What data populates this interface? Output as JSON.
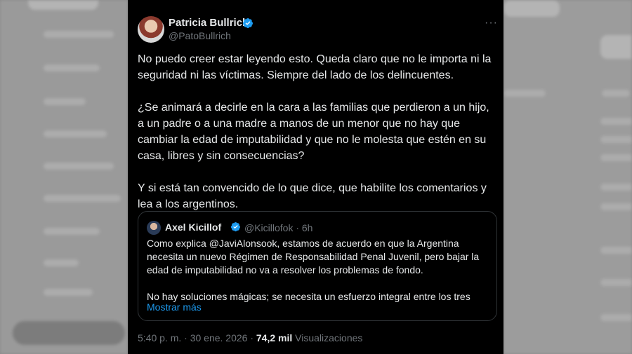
{
  "author": {
    "name": "Patricia Bullrich",
    "handle": "@PatoBullrich"
  },
  "tweet": {
    "paragraphs": [
      "No puedo creer estar leyendo esto. Queda claro que no le importa ni la seguridad ni las víctimas. Siempre del lado de los delincuentes.",
      "¿Se animará a decirle en la cara a las familias que perdieron a un hijo, a un padre o a una madre a manos de un menor que no hay que cambiar la edad de imputabilidad y que no le molesta que estén en su casa, libres y sin consecuencias?",
      "Y si está tan convencido de lo que dice, que habilite los comentarios y lea a los argentinos."
    ]
  },
  "quote": {
    "name": "Axel Kicillof",
    "handle_time": "@Kicillofok · 6h",
    "paragraphs": [
      "Como explica @JaviAlonsook, estamos de acuerdo en que la Argentina necesita un nuevo Régimen de Responsabilidad Penal Juvenil, pero bajar la edad de imputabilidad no va a resolver los problemas de fondo.",
      "No hay soluciones mágicas; se necesita un esfuerzo integral entre los tres"
    ],
    "show_more": "Mostrar más"
  },
  "meta": {
    "time_date": "5:40 p. m. · 30 ene. 2026 · ",
    "views_count": "74,2 mil",
    "views_label": " Visualizaciones"
  },
  "more_icon": "···",
  "colors": {
    "background": "#000000",
    "text": "#e7e9ea",
    "muted": "#71767b",
    "link": "#1d9bf0",
    "verified": "#1d9bf0"
  }
}
